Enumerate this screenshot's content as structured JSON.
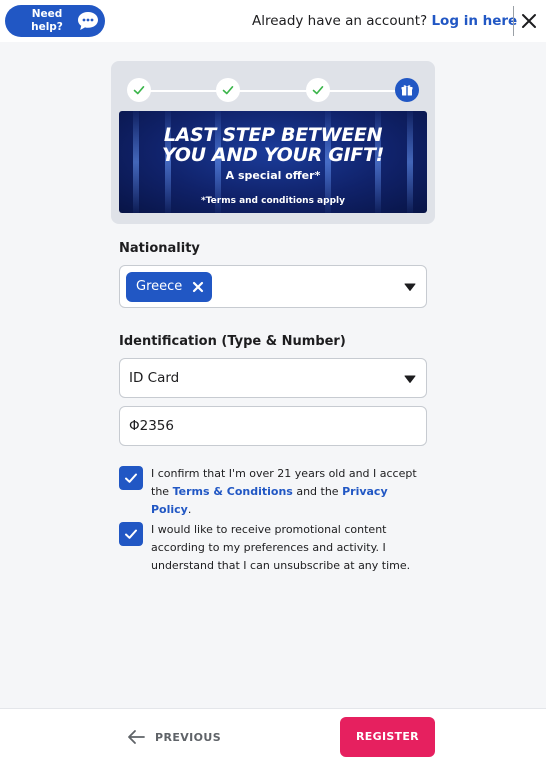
{
  "header": {
    "help_label": "Need help?",
    "help_icon": "chat-bubble-icon",
    "account_prompt": "Already have an account?",
    "login_link": "Log in here",
    "close_icon": "close-icon"
  },
  "stepper": {
    "steps": [
      {
        "state": "complete",
        "icon": "check-icon"
      },
      {
        "state": "complete",
        "icon": "check-icon"
      },
      {
        "state": "complete",
        "icon": "check-icon"
      },
      {
        "state": "current",
        "icon": "gift-icon"
      }
    ]
  },
  "banner": {
    "title_line1": "LAST STEP BETWEEN",
    "title_line2": "YOU AND YOUR GIFT!",
    "subtitle": "A special offer*",
    "terms": "*Terms and conditions apply"
  },
  "form": {
    "nationality_label": "Nationality",
    "nationality_chip": "Greece",
    "identification_label": "Identification (Type & Number)",
    "id_type_value": "ID Card",
    "id_number_value": "Φ2356"
  },
  "consents": {
    "age": {
      "checked": true,
      "text_before": "I confirm that I'm over 21 years old and I accept the ",
      "terms_link": "Terms & Conditions",
      "text_middle": " and the ",
      "privacy_link": "Privacy Policy",
      "text_after": "."
    },
    "promo": {
      "checked": true,
      "text": "I would like to receive promotional content according to my preferences and activity. I understand that I can unsubscribe at any time."
    }
  },
  "footer": {
    "previous_label": "PREVIOUS",
    "register_label": "REGISTER"
  },
  "colors": {
    "primary": "#2157c4",
    "register": "#e6205f",
    "step_check": "#3bb54a"
  }
}
